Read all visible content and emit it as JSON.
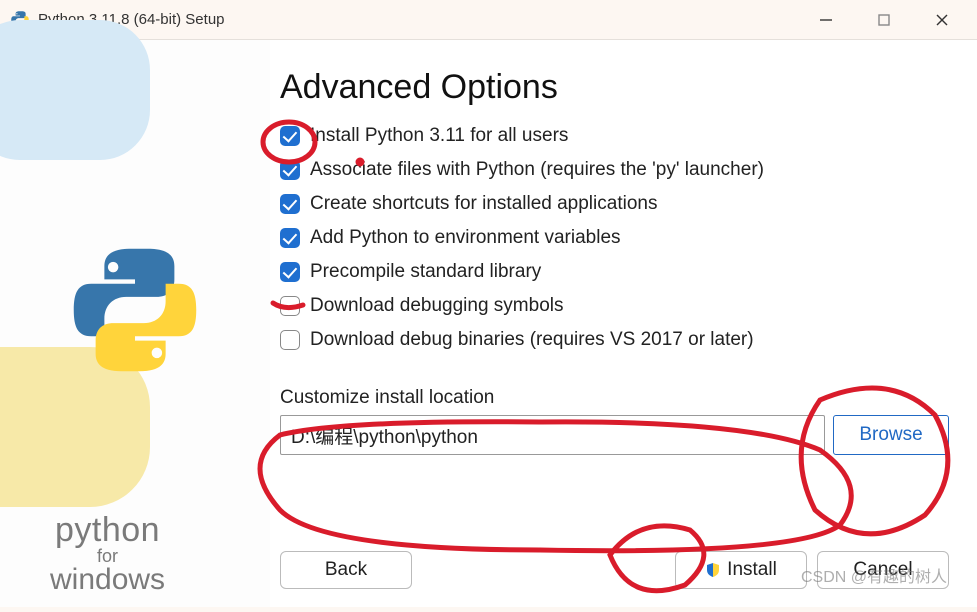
{
  "window": {
    "title": "Python 3.11.8 (64-bit) Setup"
  },
  "heading": "Advanced Options",
  "options": [
    {
      "label": "Install Python 3.11 for all users",
      "checked": true
    },
    {
      "label": "Associate files with Python (requires the 'py' launcher)",
      "checked": true
    },
    {
      "label": "Create shortcuts for installed applications",
      "checked": true
    },
    {
      "label": "Add Python to environment variables",
      "checked": true
    },
    {
      "label": "Precompile standard library",
      "checked": true
    },
    {
      "label": "Download debugging symbols",
      "checked": false
    },
    {
      "label": "Download debug binaries (requires VS 2017 or later)",
      "checked": false
    }
  ],
  "location": {
    "label": "Customize install location",
    "value": "D:\\编程\\python\\python",
    "browse": "Browse"
  },
  "buttons": {
    "back": "Back",
    "install": "Install",
    "cancel": "Cancel"
  },
  "brand": {
    "l1": "python",
    "l2": "for",
    "l3": "windows"
  },
  "watermark": "CSDN @有趣的树人"
}
